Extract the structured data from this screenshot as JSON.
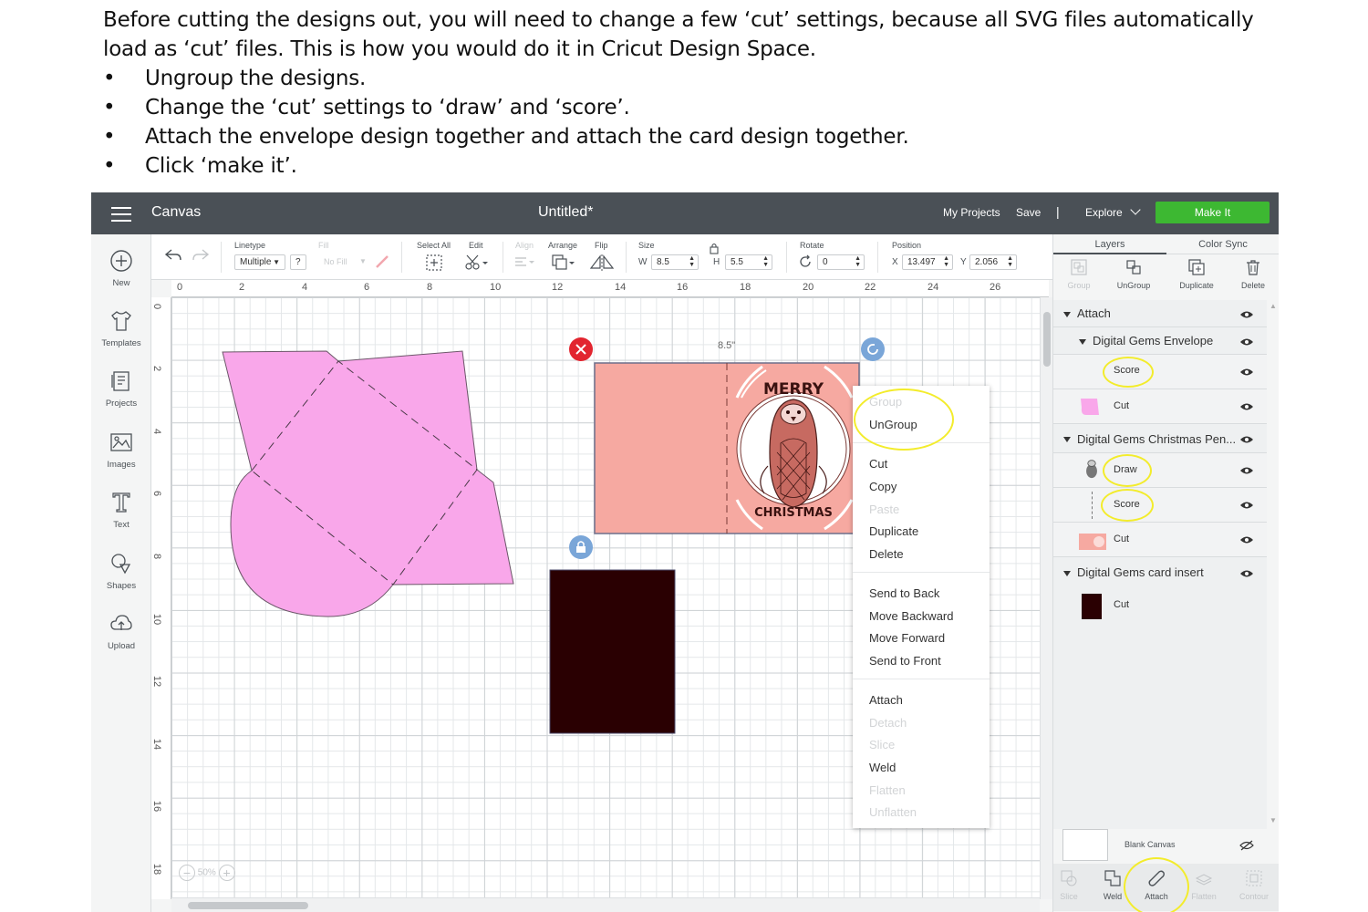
{
  "instructions": {
    "intro": "Before cutting the designs out, you will need to change a few ‘cut’ settings, because all SVG files automatically load as ‘cut’ files. This is how you would do it in Cricut Design Space.",
    "steps": [
      "Ungroup the designs.",
      "Change the ‘cut’ settings to ‘draw’ and ‘score’.",
      "Attach the envelope design together and attach the card design together.",
      "Click ‘make it’."
    ]
  },
  "topbar": {
    "title": "Canvas",
    "document": "Untitled*",
    "my_projects": "My Projects",
    "save": "Save",
    "separator": "|",
    "explore": "Explore",
    "make_it": "Make It",
    "accent": "#3db832",
    "bar_color": "#4a5056"
  },
  "leftnav": [
    {
      "label": "New",
      "icon": "plus-circle-icon"
    },
    {
      "label": "Templates",
      "icon": "tshirt-icon"
    },
    {
      "label": "Projects",
      "icon": "projects-icon"
    },
    {
      "label": "Images",
      "icon": "image-icon"
    },
    {
      "label": "Text",
      "icon": "text-icon"
    },
    {
      "label": "Shapes",
      "icon": "shapes-icon"
    },
    {
      "label": "Upload",
      "icon": "upload-icon"
    }
  ],
  "toolbar": {
    "linetype_label": "Linetype",
    "linetype_value": "Multiple",
    "linetype_help": "?",
    "fill_label": "Fill",
    "fill_value": "No Fill",
    "select_all": "Select All",
    "edit": "Edit",
    "align": "Align",
    "arrange": "Arrange",
    "flip": "Flip",
    "size_label": "Size",
    "w_label": "W",
    "w_value": "8.5",
    "h_label": "H",
    "h_value": "5.5",
    "rotate_label": "Rotate",
    "rotate_value": "0",
    "position_label": "Position",
    "x_label": "X",
    "x_value": "13.497",
    "y_label": "Y",
    "y_value": "2.056"
  },
  "ruler": {
    "top": [
      "0",
      "2",
      "4",
      "6",
      "8",
      "10",
      "12",
      "14",
      "16",
      "18",
      "20",
      "22",
      "24",
      "26"
    ],
    "left": [
      "0",
      "2",
      "4",
      "6",
      "8",
      "10",
      "12",
      "14",
      "16",
      "18"
    ]
  },
  "canvas": {
    "card_width_label": "8.5\"",
    "card_text_top": "MERRY",
    "card_text_bottom": "CHRISTMAS",
    "zoom": "50%",
    "envelope_color": "#f9a7ea",
    "card_color": "#f6a9a1",
    "insert_color": "#2a0002"
  },
  "context_menu": {
    "items": [
      {
        "label": "Group",
        "enabled": false
      },
      {
        "label": "UnGroup",
        "enabled": true
      },
      {
        "label": "Cut",
        "enabled": true
      },
      {
        "label": "Copy",
        "enabled": true
      },
      {
        "label": "Paste",
        "enabled": false
      },
      {
        "label": "Duplicate",
        "enabled": true
      },
      {
        "label": "Delete",
        "enabled": true
      },
      {
        "label": "Send to Back",
        "enabled": true
      },
      {
        "label": "Move Backward",
        "enabled": true
      },
      {
        "label": "Move Forward",
        "enabled": true
      },
      {
        "label": "Send to Front",
        "enabled": true
      },
      {
        "label": "Attach",
        "enabled": true
      },
      {
        "label": "Detach",
        "enabled": false
      },
      {
        "label": "Slice",
        "enabled": false
      },
      {
        "label": "Weld",
        "enabled": true
      },
      {
        "label": "Flatten",
        "enabled": false
      },
      {
        "label": "Unflatten",
        "enabled": false
      }
    ]
  },
  "panel": {
    "tabs": [
      "Layers",
      "Color Sync"
    ],
    "actions": [
      {
        "label": "Group",
        "enabled": false
      },
      {
        "label": "UnGroup",
        "enabled": true
      },
      {
        "label": "Duplicate",
        "enabled": true
      },
      {
        "label": "Delete",
        "enabled": true
      }
    ],
    "layers": {
      "attach": "Attach",
      "envelope_group": "Digital Gems Envelope",
      "envelope_score": "Score",
      "envelope_cut": "Cut",
      "card_group": "Digital Gems Christmas Pen...",
      "card_draw": "Draw",
      "card_score": "Score",
      "card_cut": "Cut",
      "insert_group": "Digital Gems card insert",
      "insert_cut": "Cut"
    },
    "blank_canvas": "Blank Canvas",
    "bottom_actions": [
      {
        "label": "Slice",
        "enabled": false
      },
      {
        "label": "Weld",
        "enabled": true
      },
      {
        "label": "Attach",
        "enabled": true
      },
      {
        "label": "Flatten",
        "enabled": false
      },
      {
        "label": "Contour",
        "enabled": false
      }
    ],
    "highlight_color": "#f3ec2c"
  }
}
